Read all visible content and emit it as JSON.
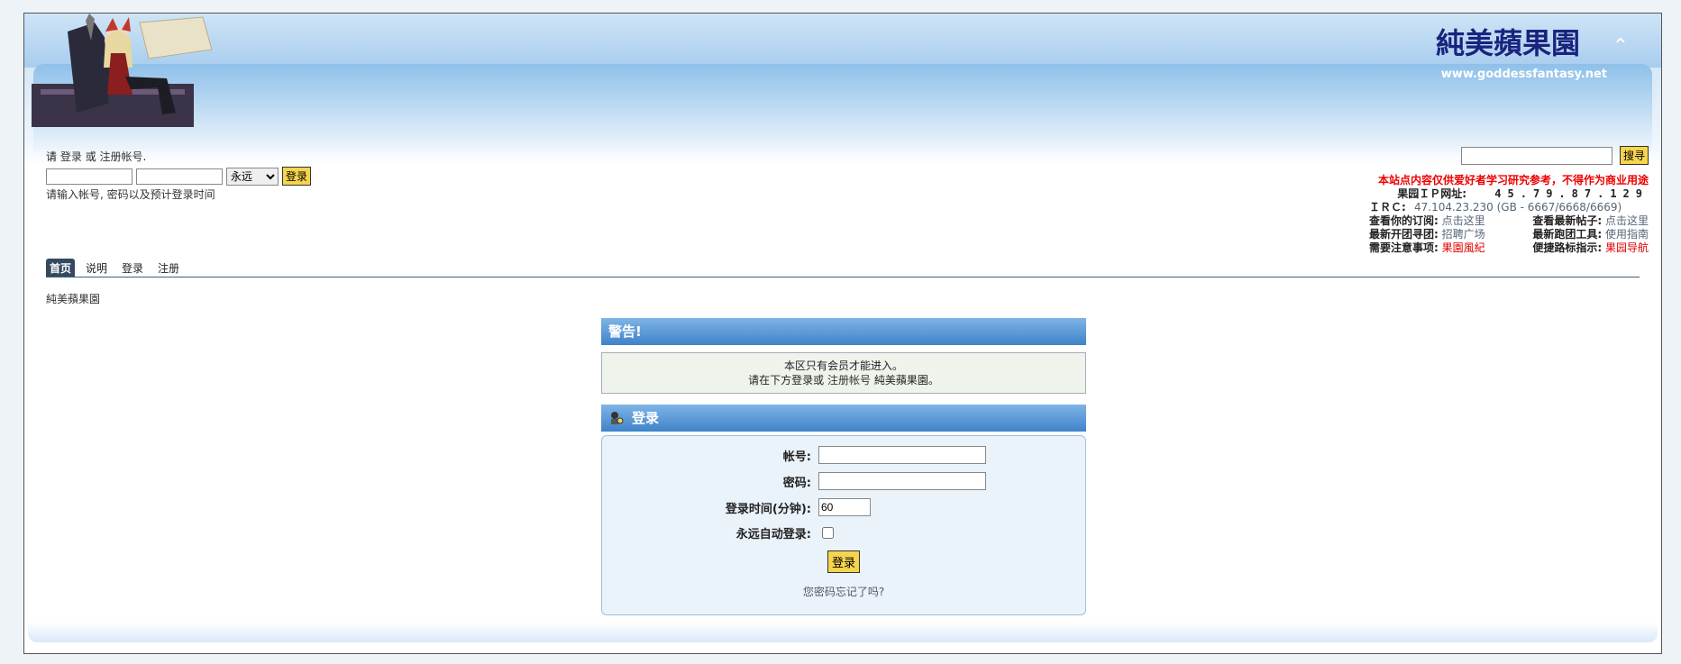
{
  "header": {
    "site_title": "純美蘋果園",
    "site_url": "www.goddessfantasy.net",
    "mascot_icon": "anime-mascot-image",
    "collapse_icon": "chevron-up-icon"
  },
  "login_bar": {
    "prefix": "请",
    "login_link": "登录",
    "or": "或",
    "register_link": "注册帐号",
    "suffix": ".",
    "duration_selected": "永远",
    "submit_label": "登录",
    "hint": "请输入帐号, 密码以及预计登录时间"
  },
  "search": {
    "button_label": "搜寻"
  },
  "notice": {
    "warning": "本站点内容仅供爱好者学习研究参考，不得作为商业用途",
    "ip_label": "果园ＩＰ网址:",
    "ip_value": "45.79.87.129",
    "irc_label": "ＩＲＣ:",
    "irc_value": "47.104.23.230  (GB - 6667/6668/6669)",
    "rows": [
      {
        "k1": "查看你的订阅:",
        "v1": "点击这里",
        "k2": "查看最新帖子:",
        "v2": "点击这里"
      },
      {
        "k1": "最新开团寻团:",
        "v1": "招聘广场",
        "k2": "最新跑团工具:",
        "v2": "使用指南"
      },
      {
        "k1": "需要注意事项:",
        "v1": "果園風紀",
        "k2": "便捷路标指示:",
        "v2": "果园导航"
      }
    ],
    "link_colors": {
      "normal": "#556677",
      "red": "#e00000"
    }
  },
  "nav": {
    "tabs": [
      "首页",
      "说明",
      "登录",
      "注册"
    ]
  },
  "breadcrumb": "純美蘋果園",
  "warning_panel": {
    "title": "警告!",
    "line1": "本区只有会员才能进入。",
    "line2_prefix": "请在下方登录或",
    "line2_link": "注册帐号",
    "line2_suffix": "純美蘋果園。"
  },
  "login_panel": {
    "title": "登录",
    "title_icon": "key-user-icon",
    "username_label": "帐号:",
    "password_label": "密码:",
    "time_label": "登录时间(分钟):",
    "time_value": "60",
    "auto_label": "永远自动登录:",
    "submit_label": "登录",
    "forgot_link": "您密码忘记了吗?"
  },
  "colors": {
    "accent": "#3f83c9",
    "title": "#1a237e",
    "button": "#f5d44e"
  }
}
